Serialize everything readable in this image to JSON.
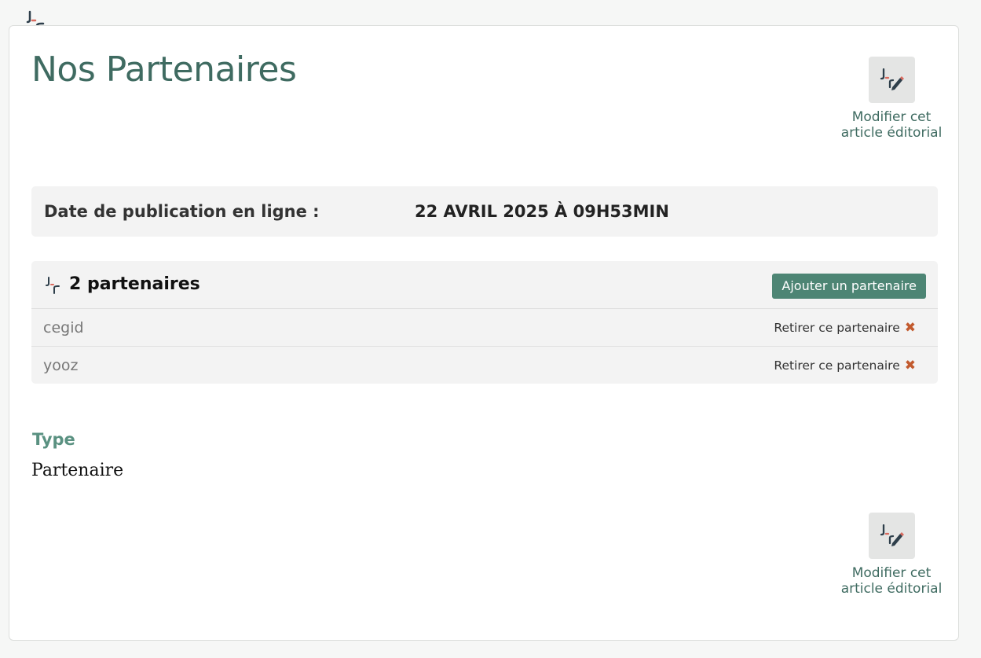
{
  "page": {
    "title": "Nos Partenaires"
  },
  "edit_actions": {
    "top_label": "Modifier cet article éditorial",
    "bottom_label": "Modifier cet article éditorial"
  },
  "publication": {
    "label": "Date de publication en ligne :",
    "value": "22 AVRIL 2025 À 09H53MIN"
  },
  "partners": {
    "count_label": "2 partenaires",
    "add_button_label": "Ajouter un partenaire",
    "remove_label": "Retirer ce partenaire",
    "remove_icon": "✖",
    "items": [
      {
        "name": "cegid"
      },
      {
        "name": "yooz"
      }
    ]
  },
  "type": {
    "label": "Type",
    "value": "Partenaire"
  },
  "colors": {
    "accent_green": "#3f6b61",
    "button_green": "#4d8574",
    "remove_orange": "#c25a2e",
    "logo_dark": "#2e3f4b",
    "logo_red": "#d96a5e"
  },
  "icons": {
    "logo": "site-logo-icon",
    "edit": "pencil-edit-icon",
    "remove": "close-x-icon"
  }
}
